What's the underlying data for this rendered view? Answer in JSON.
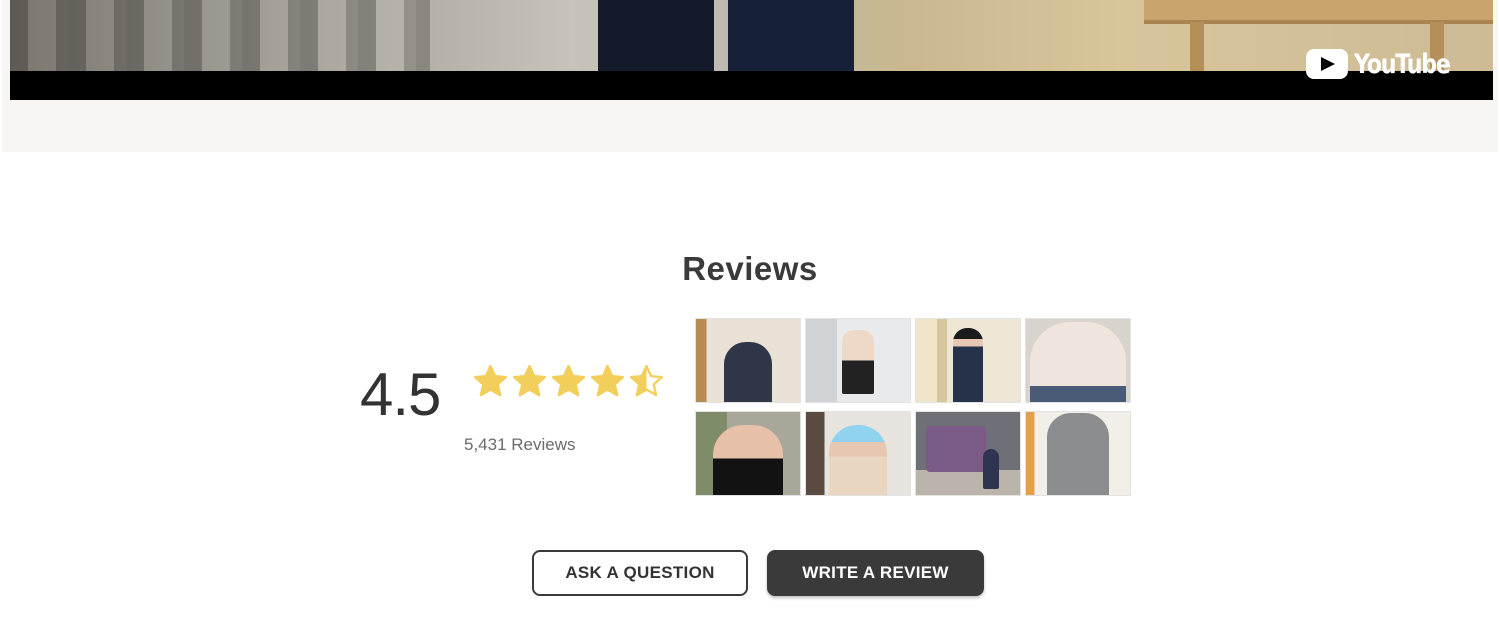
{
  "video": {
    "brand": "YouTube"
  },
  "reviews": {
    "title": "Reviews",
    "rating": "4.5",
    "rating_value": 4.5,
    "rating_max": 5,
    "count_label": "5,431 Reviews",
    "star_color": "#f2cf5b",
    "photos": [
      {
        "name": "review-photo-1"
      },
      {
        "name": "review-photo-2"
      },
      {
        "name": "review-photo-3"
      },
      {
        "name": "review-photo-4"
      },
      {
        "name": "review-photo-5"
      },
      {
        "name": "review-photo-6"
      },
      {
        "name": "review-photo-7"
      },
      {
        "name": "review-photo-8"
      }
    ]
  },
  "actions": {
    "ask_label": "ASK A QUESTION",
    "write_label": "WRITE A REVIEW"
  }
}
